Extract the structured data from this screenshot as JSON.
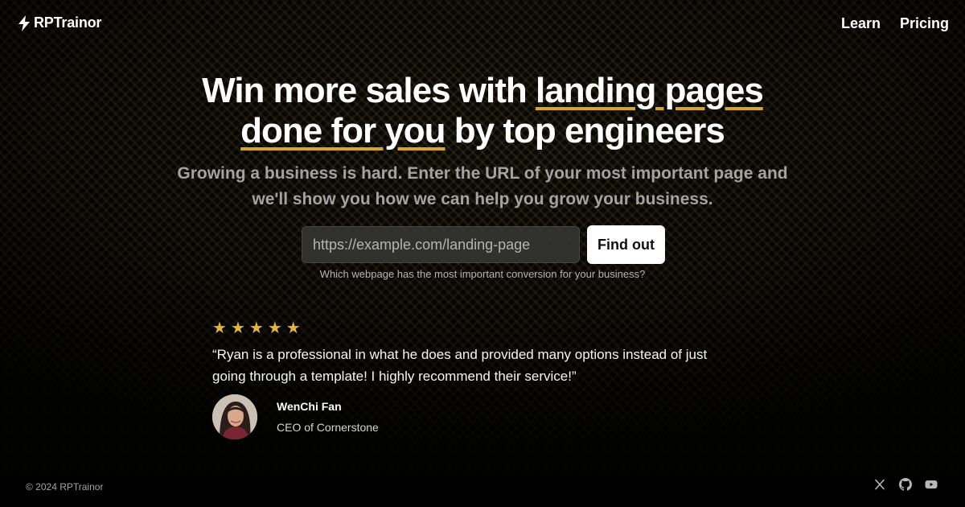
{
  "header": {
    "brand_icon": "lightning-bolt-icon",
    "brand_name": "RPTrainor",
    "nav": [
      {
        "label": "Learn"
      },
      {
        "label": "Pricing"
      }
    ]
  },
  "hero": {
    "headline_part1": "Win more sales with ",
    "headline_highlight1": "landing pages",
    "headline_highlight2": "done for you",
    "headline_part2": " by top engineers",
    "subheadline": "Growing a business is hard. Enter the URL of your most important page and we'll show you how we can help you grow your business.",
    "url_placeholder": "https://example.com/landing-page",
    "cta_label": "Find out",
    "helper_text": "Which webpage has the most important conversion for your business?"
  },
  "testimonial": {
    "rating": 5,
    "quote": "“Ryan is a professional in what he does and provided many options instead of just going through a template! I highly recommend their service!”",
    "author_name": "WenChi Fan",
    "author_role": "CEO of Cornerstone"
  },
  "footer": {
    "copyright": "© 2024 RPTrainor",
    "social": [
      {
        "icon": "x-twitter-icon"
      },
      {
        "icon": "github-icon"
      },
      {
        "icon": "youtube-icon"
      }
    ]
  },
  "colors": {
    "accent": "#d4a62a",
    "star": "#e1b43a",
    "background": "#080806",
    "text": "#ffffff",
    "muted_text": "#a3a3a3"
  }
}
